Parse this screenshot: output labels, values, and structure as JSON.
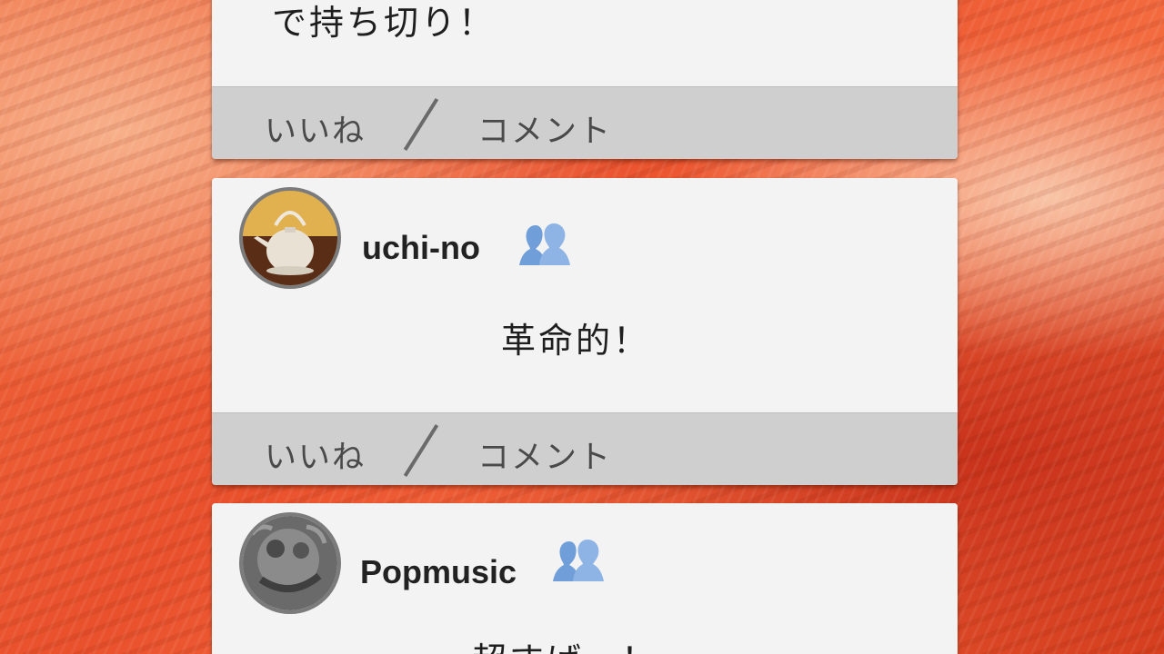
{
  "feed": {
    "posts": [
      {
        "text": "で持ち切り！",
        "actions": {
          "like": "いいね",
          "comment": "コメント"
        }
      },
      {
        "username": "uchi-no",
        "avatar_icon": "teapot-avatar",
        "badge_icon": "friends-icon",
        "text": "革命的！",
        "actions": {
          "like": "いいね",
          "comment": "コメント"
        }
      },
      {
        "username": "Popmusic",
        "avatar_icon": "statue-avatar",
        "badge_icon": "friends-icon",
        "text": "超すば…！"
      }
    ]
  },
  "colors": {
    "card_bg": "#f3f3f3",
    "action_bar_bg": "#cfcfcf",
    "badge_blue": "#6f9ed8",
    "background_orange": "#e9502c"
  }
}
